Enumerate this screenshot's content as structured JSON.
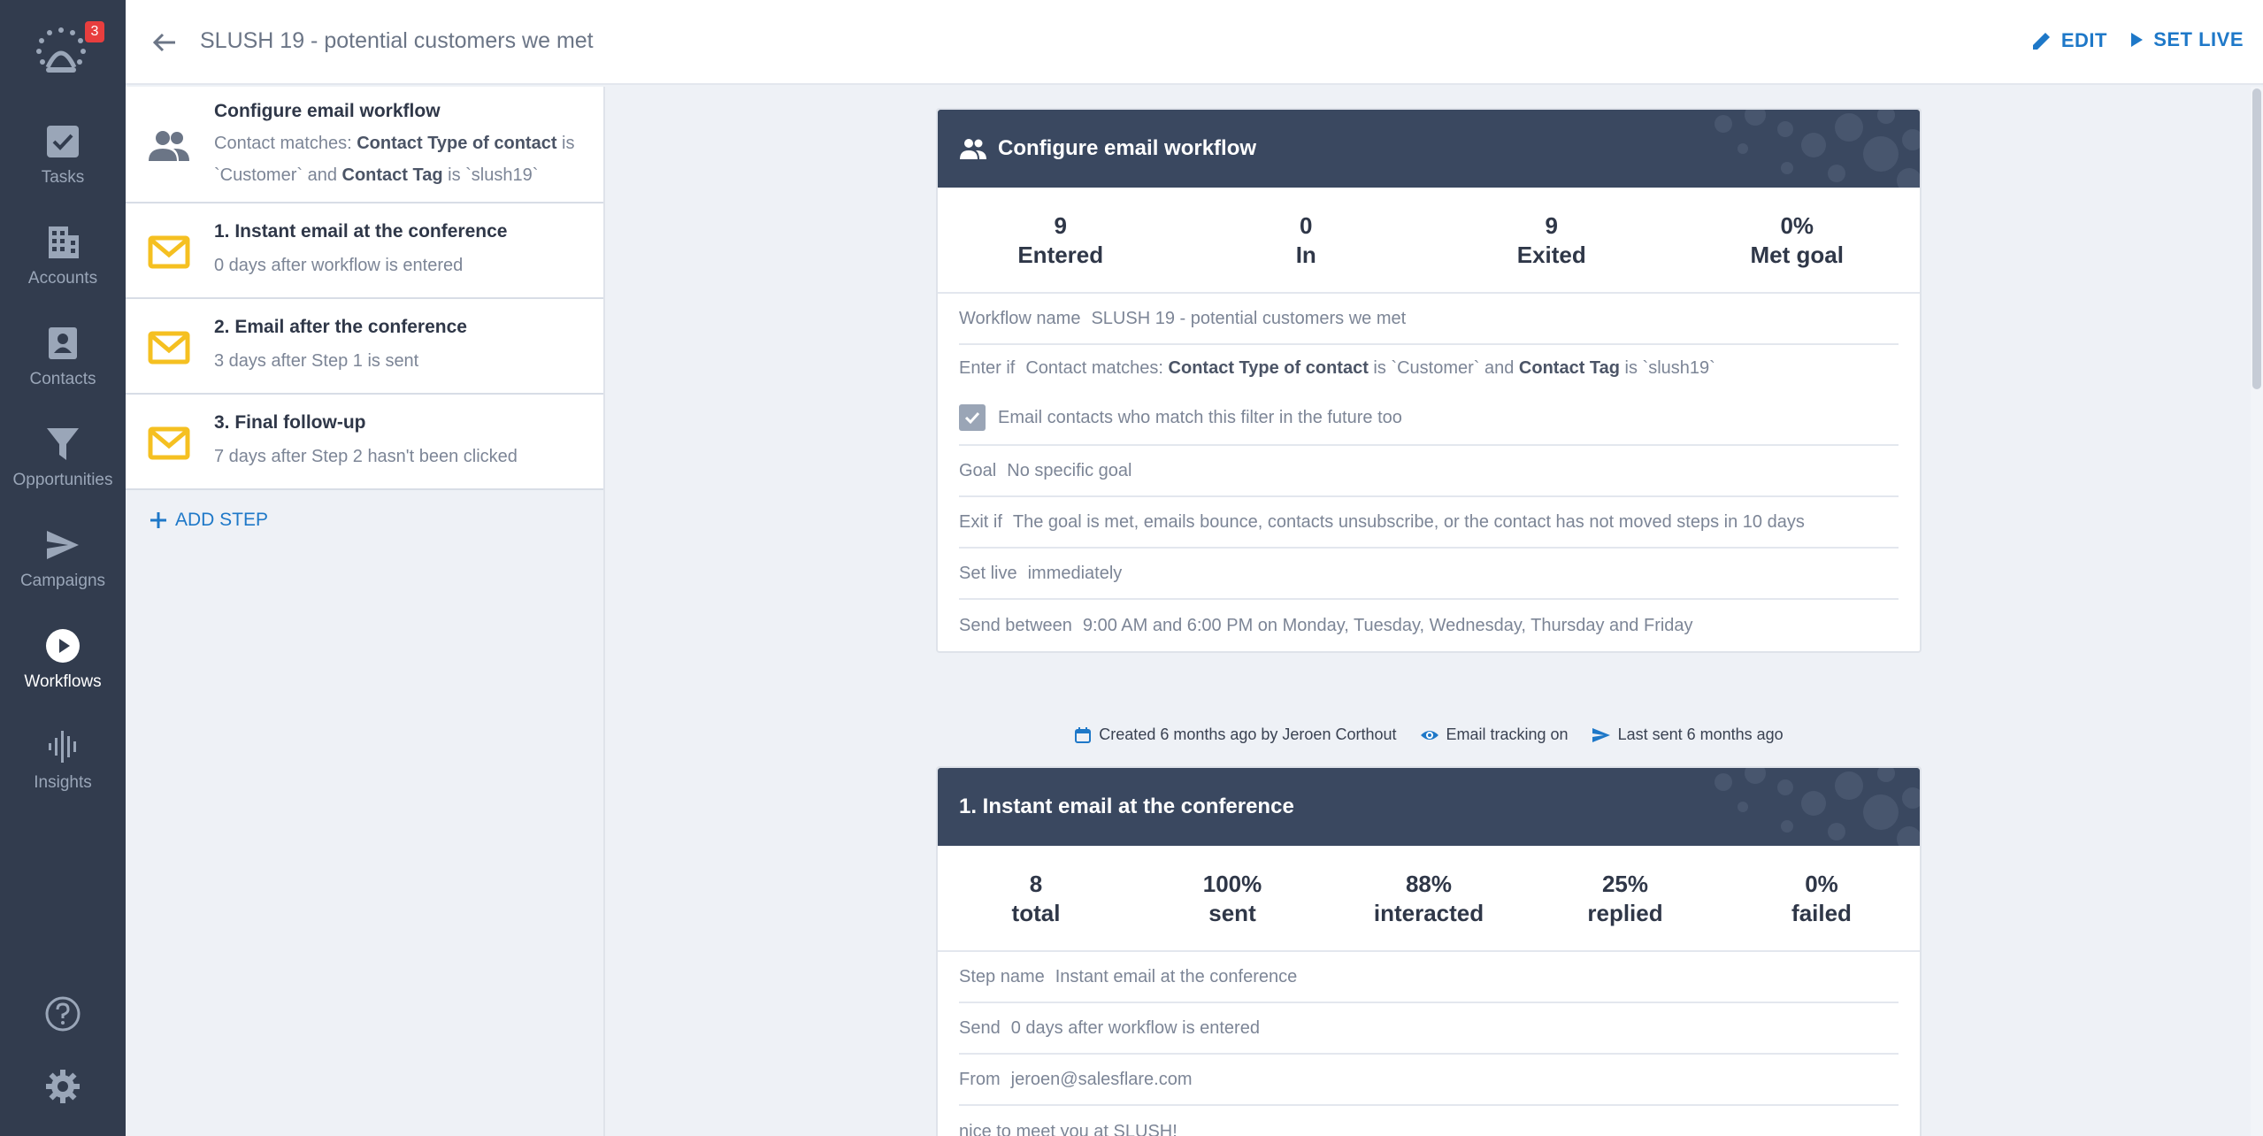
{
  "sidebar": {
    "badge": "3",
    "items": [
      {
        "label": "Tasks",
        "icon": "check-square-icon"
      },
      {
        "label": "Accounts",
        "icon": "building-icon"
      },
      {
        "label": "Contacts",
        "icon": "contact-card-icon"
      },
      {
        "label": "Opportunities",
        "icon": "funnel-icon"
      },
      {
        "label": "Campaigns",
        "icon": "paper-plane-icon"
      },
      {
        "label": "Workflows",
        "icon": "play-circle-icon"
      },
      {
        "label": "Insights",
        "icon": "waveform-icon"
      }
    ],
    "active": "Workflows"
  },
  "header": {
    "title": "SLUSH 19 - potential customers we met",
    "edit_label": "EDIT",
    "setlive_label": "SET LIVE"
  },
  "steps": {
    "config": {
      "title": "Configure email workflow",
      "desc_prefix": "Contact matches: ",
      "desc_b1": "Contact Type of contact",
      "desc_mid1": " is `Customer` and ",
      "desc_b2": "Contact Tag",
      "desc_mid2": " is `slush19`"
    },
    "items": [
      {
        "title": "1. Instant email at the conference",
        "desc": "0 days after workflow is entered"
      },
      {
        "title": "2. Email after the conference",
        "desc": "3 days after Step 1 is sent"
      },
      {
        "title": "3. Final follow-up",
        "desc": "7 days after Step 2 hasn't been clicked"
      }
    ],
    "add_label": "ADD STEP"
  },
  "workflow_card": {
    "title": "Configure email workflow",
    "stats": [
      {
        "value": "9",
        "label": "Entered"
      },
      {
        "value": "0",
        "label": "In"
      },
      {
        "value": "9",
        "label": "Exited"
      },
      {
        "value": "0%",
        "label": "Met goal"
      }
    ],
    "name_key": "Workflow name",
    "name_val": "SLUSH 19 - potential customers we met",
    "enter_key": "Enter if",
    "enter_prefix": "Contact matches: ",
    "enter_b1": "Contact Type of contact",
    "enter_mid1": " is `Customer` and ",
    "enter_b2": "Contact Tag",
    "enter_mid2": " is `slush19`",
    "future_label": "Email contacts who match this filter in the future too",
    "goal_key": "Goal",
    "goal_val": "No specific goal",
    "exit_key": "Exit if",
    "exit_val": "The goal is met, emails bounce, contacts unsubscribe, or the contact has not moved steps in 10 days",
    "setlive_key": "Set live",
    "setlive_val": "immediately",
    "send_key": "Send between",
    "send_val": "9:00 AM and 6:00 PM on Monday, Tuesday, Wednesday, Thursday and Friday"
  },
  "meta": {
    "created": "Created 6 months ago by Jeroen Corthout",
    "tracking": "Email tracking on",
    "last_sent": "Last sent 6 months ago"
  },
  "email_card": {
    "title": "1. Instant email at the conference",
    "stats": [
      {
        "value": "8",
        "label": "total"
      },
      {
        "value": "100%",
        "label": "sent"
      },
      {
        "value": "88%",
        "label": "interacted"
      },
      {
        "value": "25%",
        "label": "replied"
      },
      {
        "value": "0%",
        "label": "failed"
      }
    ],
    "stepname_key": "Step name",
    "stepname_val": "Instant email at the conference",
    "send_key": "Send",
    "send_val": "0 days after workflow is entered",
    "from_key": "From",
    "from_val": "jeroen@salesflare.com",
    "subject_val": "nice to meet you at SLUSH!"
  },
  "colors": {
    "sidebar": "#323c4e",
    "accent": "#1e78c8",
    "card_header": "#3a4860",
    "envelope": "#f5c021"
  }
}
